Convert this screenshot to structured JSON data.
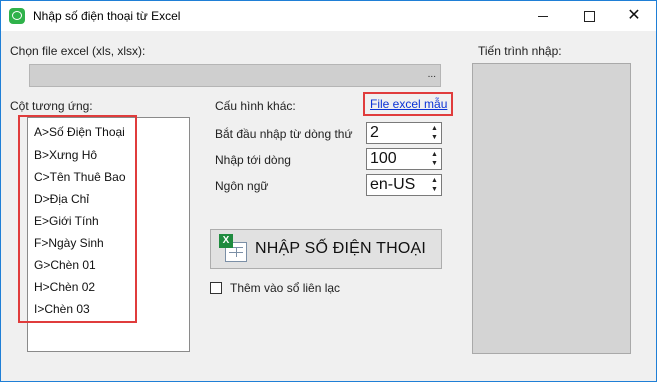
{
  "window": {
    "title": "Nhập số điện thoại từ Excel",
    "icon": "chat-bubble-icon",
    "controls": [
      "minimize-icon",
      "maximize-icon",
      "close-icon"
    ]
  },
  "file_section": {
    "label": "Chọn file excel (xls, xlsx):",
    "value": "",
    "browse_label": "..."
  },
  "columns_section": {
    "label": "Cột tương ứng:",
    "items": [
      "A>Số Điện Thoại",
      "B>Xưng Hô",
      "C>Tên Thuê Bao",
      "D>Địa Chỉ",
      "E>Giới Tính",
      "F>Ngày Sinh",
      "G>Chèn 01",
      "H>Chèn 02",
      "I>Chèn 03"
    ]
  },
  "config": {
    "label": "Cấu hình khác:",
    "sample_link": "File excel mẫu",
    "start_row_label": "Bắt đầu nhập từ dòng thứ",
    "start_row_value": "2",
    "end_row_label": "Nhập tới dòng",
    "end_row_value": "100",
    "language_label": "Ngôn ngữ",
    "language_value": "en-US"
  },
  "import_button": {
    "label": "NHẬP SỐ ĐIỆN THOẠI",
    "icon": "excel-import-icon"
  },
  "add_contacts_checkbox": {
    "label": "Thêm vào sổ liên lạc",
    "checked": false
  },
  "progress_section": {
    "label": "Tiến trình nhập:"
  },
  "colors": {
    "highlight": "#e03c3c",
    "link": "#0b33d6",
    "accent_border": "#1f7fd6"
  }
}
